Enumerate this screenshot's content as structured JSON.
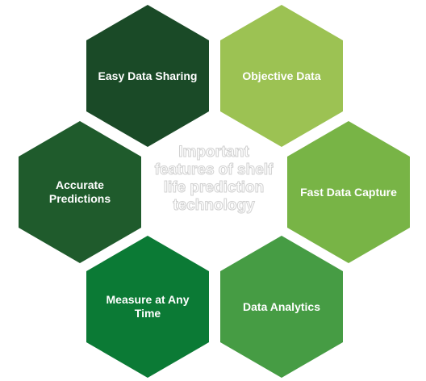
{
  "diagram": {
    "center_title": "Important features of shelf life prediction technology",
    "hexagons": [
      {
        "id": "easy",
        "label": "Easy Data Sharing",
        "color": "#1a4a27"
      },
      {
        "id": "objective",
        "label": "Objective Data",
        "color": "#9cc253"
      },
      {
        "id": "accurate",
        "label": "Accurate Predictions",
        "color": "#1f5b2c"
      },
      {
        "id": "fast",
        "label": "Fast Data Capture",
        "color": "#78b446"
      },
      {
        "id": "measure",
        "label": "Measure at Any Time",
        "color": "#0b7a35"
      },
      {
        "id": "analytics",
        "label": "Data Analytics",
        "color": "#469c44"
      }
    ]
  }
}
